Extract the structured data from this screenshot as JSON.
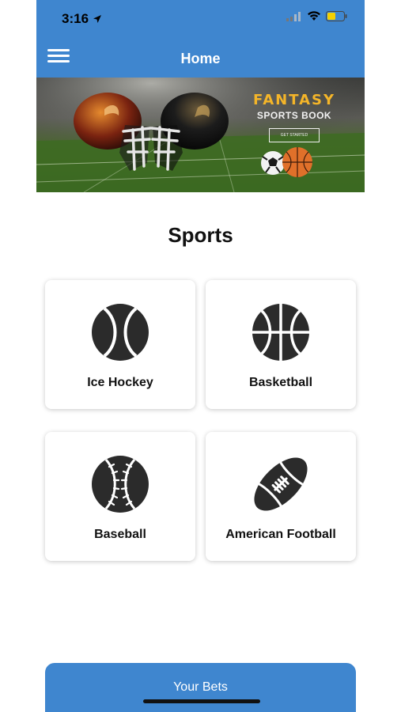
{
  "status_bar": {
    "time": "3:16"
  },
  "nav": {
    "title": "Home"
  },
  "banner": {
    "headline": "FANTASY",
    "subtitle": "SPORTS BOOK",
    "cta": "GET STARTED"
  },
  "main": {
    "title": "Sports",
    "sports": [
      {
        "label": "Ice Hockey",
        "icon": "tennis-ball-icon"
      },
      {
        "label": "Basketball",
        "icon": "basketball-icon"
      },
      {
        "label": "Baseball",
        "icon": "baseball-icon"
      },
      {
        "label": "American Football",
        "icon": "american-football-icon"
      }
    ]
  },
  "footer": {
    "your_bets_label": "Your Bets"
  },
  "colors": {
    "header_bg": "#3f86cf",
    "button_bg": "#3f86cf",
    "icon_fill": "#2b2b2b",
    "banner_gold": "#f4b529",
    "battery": "#f5d000"
  }
}
